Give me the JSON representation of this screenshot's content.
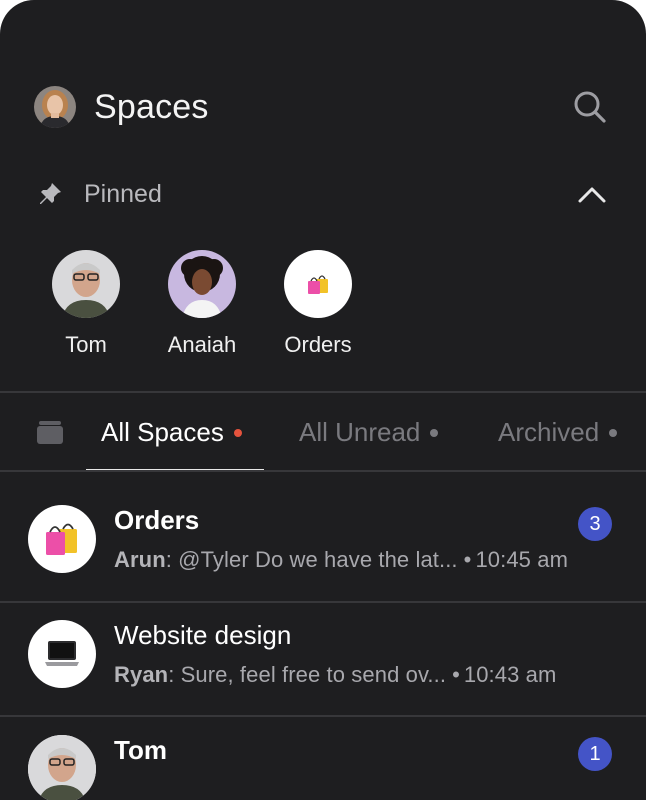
{
  "header": {
    "title": "Spaces",
    "avatar_icon": "user-avatar",
    "search_icon": "search-icon"
  },
  "pinned": {
    "label": "Pinned",
    "items": [
      {
        "name": "Tom",
        "icon": "person-avatar"
      },
      {
        "name": "Anaiah",
        "icon": "person-avatar"
      },
      {
        "name": "Orders",
        "icon": "shopping-bags-icon"
      }
    ]
  },
  "tabs": [
    {
      "label": "All Spaces",
      "active": true,
      "dot_color": "#e5533d"
    },
    {
      "label": "All Unread",
      "active": false,
      "dot_color": "#7a7a7f"
    },
    {
      "label": "Archived",
      "active": false,
      "dot_color": "#7a7a7f"
    }
  ],
  "conversations": [
    {
      "name": "Orders",
      "sender": "Arun",
      "message": "@Tyler Do we have the lat...",
      "time": "10:45 am",
      "badge": "3",
      "bold": true,
      "icon": "shopping-bags-icon"
    },
    {
      "name": "Website design",
      "sender": "Ryan",
      "message": "Sure, feel free to send ov...",
      "time": "10:43 am",
      "badge": "",
      "bold": false,
      "icon": "laptop-icon"
    },
    {
      "name": "Tom",
      "sender": "",
      "message": "",
      "time": "",
      "badge": "1",
      "bold": true,
      "icon": "person-avatar"
    }
  ],
  "colors": {
    "background": "#1e1e20",
    "badge": "#4454c7",
    "active_dot": "#e5533d"
  }
}
